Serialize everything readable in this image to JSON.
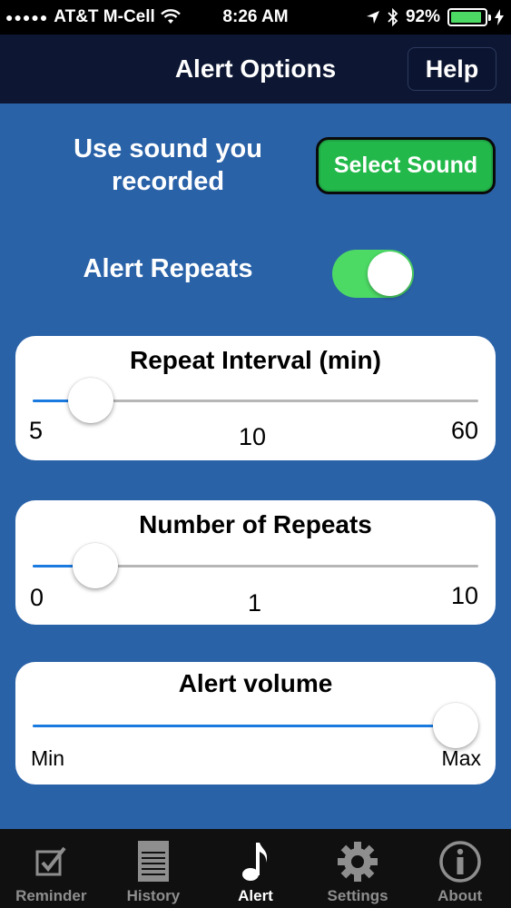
{
  "status_bar": {
    "carrier": "AT&T M-Cell",
    "time": "8:26 AM",
    "battery": "92%",
    "battery_level": 0.92
  },
  "nav": {
    "title": "Alert Options",
    "help_label": "Help"
  },
  "sound": {
    "label": "Use sound you recorded",
    "button_label": "Select Sound"
  },
  "repeats_toggle": {
    "label": "Alert Repeats",
    "on": true
  },
  "sliders": [
    {
      "title": "Repeat Interval (min)",
      "min_label": "5",
      "mid_label": "10",
      "max_label": "60",
      "value": 10,
      "fraction": 0.13
    },
    {
      "title": "Number of Repeats",
      "min_label": "0",
      "mid_label": "1",
      "max_label": "10",
      "value": 1,
      "fraction": 0.14
    },
    {
      "title": "Alert volume",
      "min_label": "Min",
      "max_label": "Max",
      "fraction": 0.95
    }
  ],
  "tabs": [
    {
      "label": "Reminder",
      "icon": "checkbox-icon",
      "active": false
    },
    {
      "label": "History",
      "icon": "notepad-icon",
      "active": false
    },
    {
      "label": "Alert",
      "icon": "music-note-icon",
      "active": true
    },
    {
      "label": "Settings",
      "icon": "gear-icon",
      "active": false
    },
    {
      "label": "About",
      "icon": "info-icon",
      "active": false
    }
  ],
  "colors": {
    "background": "#2a62a8",
    "nav": "#0d1733",
    "accent_green": "#22b84a",
    "toggle_on": "#4cd964",
    "slider_fill": "#1a7ae0"
  }
}
